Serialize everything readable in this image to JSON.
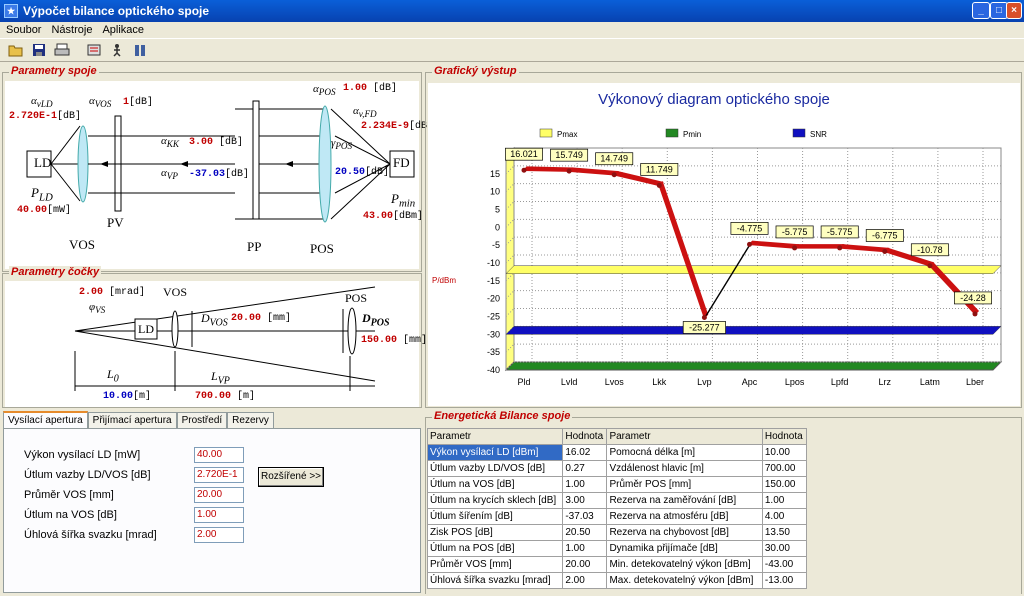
{
  "window": {
    "title": "Výpočet bilance optického spoje",
    "min": "_",
    "max": "□",
    "close": "×"
  },
  "menu": [
    "Soubor",
    "Nástroje",
    "Aplikace"
  ],
  "toolbar": {
    "icons": [
      "open-icon",
      "save-icon",
      "print-icon",
      "calculator-icon",
      "run-icon",
      "user-icon"
    ]
  },
  "groups": {
    "params": "Parametry spoje",
    "lens": "Parametry čočky",
    "graph": "Grafický výstup",
    "bilance": "Energetická Bilance spoje"
  },
  "schematic": {
    "a_ld_sym": "α",
    "a_ld_sub": "vLD",
    "a_ld_val": "2.720E-1",
    "a_ld_unit": "[dB]",
    "a_vos_sym": "α",
    "a_vos_sub": "VOS",
    "a_vos_val": "1",
    "a_vos_unit": "[dB]",
    "a_kk_sym": "α",
    "a_kk_sub": "KK",
    "a_kk_val": "3.00",
    "a_kk_unit": "[dB]",
    "a_vp_sym": "α",
    "a_vp_sub": "VP",
    "a_vp_val": "-37.03",
    "a_vp_unit": "[dB]",
    "a_pos_sym": "α",
    "a_pos_sub": "POS",
    "a_pos_val": "1.00",
    "a_pos_unit": "[dB]",
    "a_fd_sym": "α",
    "a_fd_sub": "v,FD",
    "a_fd_val": "2.234E-9",
    "a_fd_unit": "[dB]",
    "g_pos_sym": "γ",
    "g_pos_sub": "POS",
    "g_pos_val": "20.50",
    "g_pos_unit": "[dB]",
    "p_ld_sym": "P",
    "p_ld_sub": "LD",
    "p_ld_val": "40.00",
    "p_ld_unit": "[mW]",
    "p_min_sym": "P",
    "p_min_sub": "min",
    "p_min_val": "43.00",
    "p_min_unit": "[dBm]",
    "ld": "LD",
    "fd": "FD",
    "pv": "PV",
    "pp": "PP",
    "vos": "VOS",
    "pos": "POS"
  },
  "lens": {
    "phi_val": "2.00",
    "phi_unit": "[mrad]",
    "phi_sym": "φ",
    "phi_sub": "VS",
    "vos": "VOS",
    "pos": "POS",
    "ld": "LD",
    "dvos_sym": "D",
    "dvos_sub": "VOS",
    "dvos_val": "20.00",
    "dvos_unit": "[mm]",
    "dpos_sym": "D",
    "dpos_sub": "POS",
    "dpos_val": "150.00",
    "dpos_unit": "[mm]",
    "l0_sym": "L",
    "l0_sub": "0",
    "l0_val": "10.00",
    "l0_unit": "[m]",
    "lvp_sym": "L",
    "lvp_sub": "VP",
    "lvp_val": "700.00",
    "lvp_unit": "[m]"
  },
  "tabs": [
    "Vysílací apertura",
    "Přijímací apertura",
    "Prostředí",
    "Rezervy"
  ],
  "form": {
    "fields": [
      {
        "label": "Výkon vysílací LD  [mW]",
        "value": "40.00"
      },
      {
        "label": "Útlum vazby LD/VOS [dB]",
        "value": "2.720E-1"
      },
      {
        "label": "Průměr VOS [mm]",
        "value": "20.00"
      },
      {
        "label": "Útlum na VOS [dB]",
        "value": "1.00"
      },
      {
        "label": "Úhlová šířka svazku [mrad]",
        "value": "2.00"
      }
    ],
    "advanced": "Rozšířené >>"
  },
  "table": {
    "headers": [
      "Parametr",
      "Hodnota",
      "Parametr",
      "Hodnota"
    ],
    "rows": [
      [
        "Výkon vysílací LD [dBm]",
        "16.02",
        "Pomocná délka [m]",
        "10.00"
      ],
      [
        "Útlum vazby LD/VOS [dB]",
        "0.27",
        "Vzdálenost hlavic [m]",
        "700.00"
      ],
      [
        "Útlum na VOS [dB]",
        "1.00",
        "Průměr POS [mm]",
        "150.00"
      ],
      [
        "Útlum na krycích sklech [dB]",
        "3.00",
        "Rezerva na zaměřování [dB]",
        "1.00"
      ],
      [
        "Útlum šířením [dB]",
        "-37.03",
        "Rezerva na atmosféru [dB]",
        "4.00"
      ],
      [
        "Zisk POS [dB]",
        "20.50",
        "Rezerva na chybovost [dB]",
        "13.50"
      ],
      [
        "Útlum na POS [dB]",
        "1.00",
        "Dynamika přijímače [dB]",
        "30.00"
      ],
      [
        "Průměr VOS [mm]",
        "20.00",
        "Min. detekovatelný výkon [dBm]",
        "-43.00"
      ],
      [
        "Úhlová šířka svazku [mrad]",
        "2.00",
        "Max. detekovatelný výkon [dBm]",
        "-13.00"
      ]
    ]
  },
  "chart_data": {
    "type": "line",
    "title": "Výkonový diagram optického spoje",
    "ylabel": "P/dBm",
    "xlabel": "",
    "ylim": [
      -40,
      20
    ],
    "yticks": [
      15,
      10,
      5,
      0,
      -5,
      -10,
      -15,
      -20,
      -25,
      -30,
      -35,
      -40
    ],
    "categories": [
      "Pld",
      "Lvld",
      "Lvos",
      "Lkk",
      "Lvp",
      "Apc",
      "Lpos",
      "Lpfd",
      "Lrz",
      "Latm",
      "Lber"
    ],
    "series": [
      {
        "name": "",
        "values": [
          16.021,
          15.749,
          14.749,
          11.749,
          -25.277,
          -4.775,
          -5.775,
          -5.775,
          -6.775,
          -10.78,
          -24.28
        ],
        "color": "#cc1111"
      }
    ],
    "datalabels": [
      "16.021",
      "15.749",
      "14.749",
      "11.749",
      "-25.277",
      "-4.775",
      "-5.775",
      "-5.775",
      "-6.775",
      "-10.78",
      "-24.28"
    ],
    "legend": [
      {
        "name": "Pmax",
        "color": "#ffff66",
        "value": -13
      },
      {
        "name": "Pmin",
        "color": "#228822",
        "value": -43
      },
      {
        "name": "SNR",
        "color": "#1010c0",
        "value": -30
      }
    ],
    "grid": true
  }
}
